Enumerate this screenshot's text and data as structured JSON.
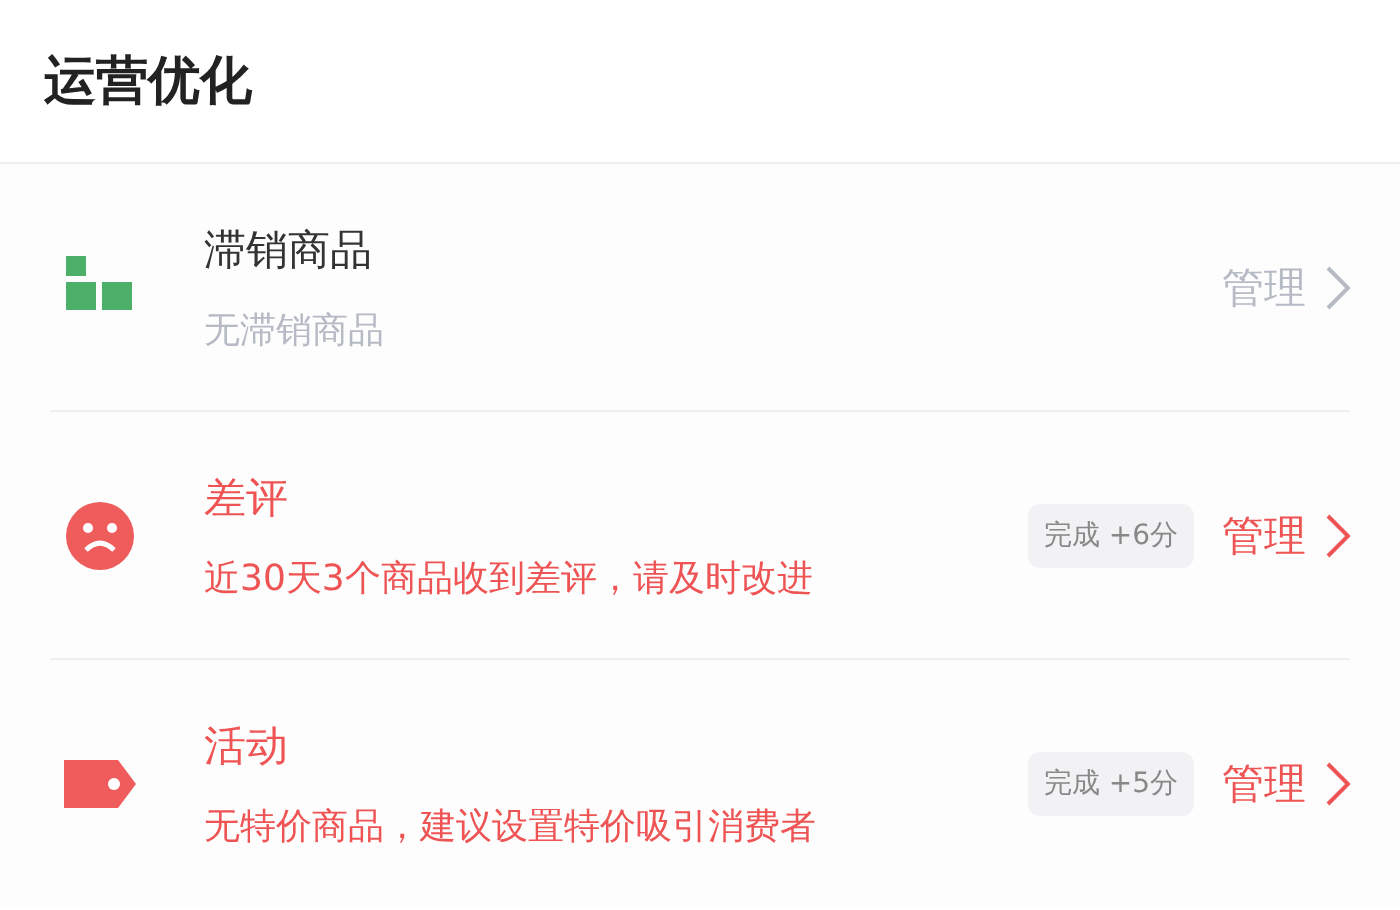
{
  "header": {
    "title": "运营优化"
  },
  "items": [
    {
      "kind": "grid",
      "title": "滞销商品",
      "subtitle": "无滞销商品",
      "alert": false,
      "action": "管理"
    },
    {
      "kind": "sad",
      "title": "差评",
      "subtitle": "近30天3个商品收到差评，请及时改进",
      "alert": true,
      "badge": "完成 +6分",
      "action": "管理"
    },
    {
      "kind": "tag",
      "title": "活动",
      "subtitle": "无特价商品，建议设置特价吸引消费者",
      "alert": true,
      "badge": "完成 +5分",
      "action": "管理"
    }
  ]
}
